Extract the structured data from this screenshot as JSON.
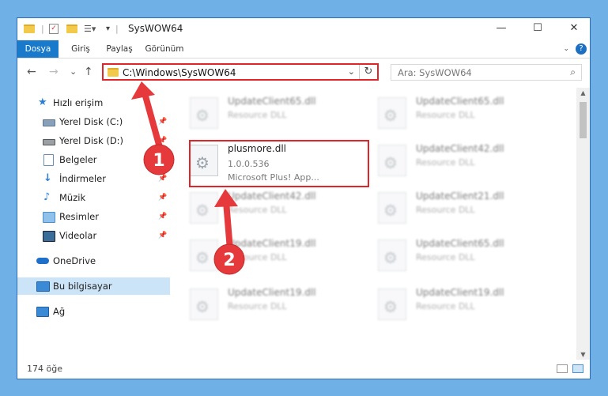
{
  "window": {
    "title": "SysWOW64",
    "controls": {
      "minimize": "—",
      "maximize": "☐",
      "close": "✕"
    }
  },
  "ribbon": {
    "tabs": [
      "Dosya",
      "Giriş",
      "Paylaş",
      "Görünüm"
    ],
    "help": "?"
  },
  "nav": {
    "back": "←",
    "forward": "→",
    "recent": "⌄",
    "up": "↑",
    "address": "C:\\Windows\\SysWOW64",
    "search_placeholder": "Ara: SysWOW64"
  },
  "sidebar": {
    "items": [
      {
        "label": "Hızlı erişim",
        "icon": "star-icon",
        "color": "#2a7fd4"
      },
      {
        "label": "Yerel Disk (C:)",
        "icon": "drive-icon",
        "color": "#3b7bbf",
        "pinned": true
      },
      {
        "label": "Yerel Disk (D:)",
        "icon": "drive-icon",
        "color": "#555555",
        "pinned": true
      },
      {
        "label": "Belgeler",
        "icon": "documents-icon",
        "color": "#6a8fb5",
        "pinned": true
      },
      {
        "label": "İndirmeler",
        "icon": "download-icon",
        "color": "#2a7fd4",
        "pinned": true
      },
      {
        "label": "Müzik",
        "icon": "music-icon",
        "color": "#2a7fd4",
        "pinned": true
      },
      {
        "label": "Resimler",
        "icon": "pictures-icon",
        "color": "#4f8fc7",
        "pinned": true
      },
      {
        "label": "Videolar",
        "icon": "videos-icon",
        "color": "#3a6e9a",
        "pinned": true
      },
      {
        "label": "OneDrive",
        "icon": "cloud-icon",
        "color": "#1e6fc9"
      },
      {
        "label": "Bu bilgisayar",
        "icon": "computer-icon",
        "color": "#3b8ad6",
        "selected": true
      },
      {
        "label": "Ağ",
        "icon": "network-icon",
        "color": "#3b8ad6"
      }
    ]
  },
  "files": {
    "highlighted": {
      "name": "plusmore.dll",
      "version": "1.0.0.536",
      "description": "Microsoft Plus! App..."
    },
    "blurred": [
      {
        "name": "UpdateClient65.dll",
        "sub": "Resource DLL"
      },
      {
        "name": "UpdateClient65.dll",
        "sub": "Resource DLL"
      },
      {
        "name": "UpdateClient42.dll",
        "sub": "Resource DLL"
      },
      {
        "name": "UpdateClient42.dll",
        "sub": "Resource DLL"
      },
      {
        "name": "UpdateClient21.dll",
        "sub": "Resource DLL"
      },
      {
        "name": "UpdateClient19.dll",
        "sub": "Resource DLL"
      },
      {
        "name": "UpdateClient65.dll",
        "sub": "Resource DLL"
      },
      {
        "name": "UpdateClient19.dll",
        "sub": "Resource DLL"
      },
      {
        "name": "UpdateClient19.dll",
        "sub": "Resource DLL"
      }
    ]
  },
  "status": {
    "count": "174 öğe"
  },
  "annotations": {
    "badge1": "1",
    "badge2": "2",
    "arrow_color": "#e5393b"
  }
}
